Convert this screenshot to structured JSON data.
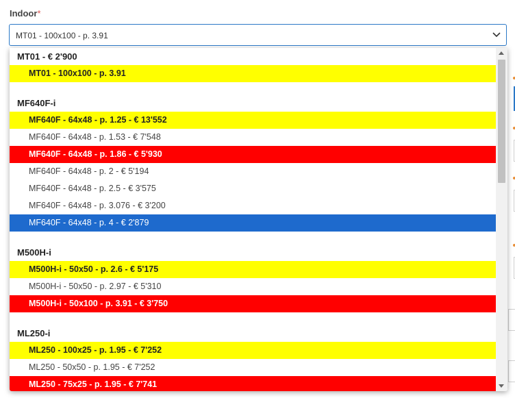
{
  "field": {
    "label": "Indoor",
    "required_mark": "*",
    "selected_value": "MT01 - 100x100 - p. 3.91"
  },
  "colors": {
    "highlight_yellow": "#ffff00",
    "highlight_red": "#ff0000",
    "selected_blue": "#1e6acd",
    "focus_border": "#2a78c7",
    "required": "#d9534f"
  },
  "groups": [
    {
      "label": "MT01 - € 2'900",
      "options": [
        {
          "text": "MT01 - 100x100 - p. 3.91",
          "style": "yellow"
        }
      ]
    },
    {
      "label": "MF640F-i",
      "options": [
        {
          "text": "MF640F - 64x48 - p. 1.25 - € 13'552",
          "style": "yellow"
        },
        {
          "text": "MF640F - 64x48 - p. 1.53 - € 7'548",
          "style": "plain"
        },
        {
          "text": "MF640F - 64x48 - p. 1.86 - € 5'930",
          "style": "red"
        },
        {
          "text": "MF640F - 64x48 - p. 2 - € 5'194",
          "style": "plain"
        },
        {
          "text": "MF640F - 64x48 - p. 2.5 - € 3'575",
          "style": "plain"
        },
        {
          "text": "MF640F - 64x48 - p. 3.076 - € 3'200",
          "style": "plain"
        },
        {
          "text": "MF640F - 64x48 - p. 4 - € 2'879",
          "style": "selected"
        }
      ]
    },
    {
      "label": "M500H-i",
      "options": [
        {
          "text": "M500H-i - 50x50 - p. 2.6 - € 5'175",
          "style": "yellow"
        },
        {
          "text": "M500H-i - 50x50 - p. 2.97 - € 5'310",
          "style": "plain"
        },
        {
          "text": "M500H-i - 50x100 - p. 3.91 - € 3'750",
          "style": "red"
        }
      ]
    },
    {
      "label": "ML250-i",
      "options": [
        {
          "text": "ML250 - 100x25 - p. 1.95 - € 7'252",
          "style": "yellow"
        },
        {
          "text": "ML250 - 50x50 - p. 1.95 - € 7'252",
          "style": "plain"
        },
        {
          "text": "ML250 - 75x25 - p. 1.95 - € 7'741",
          "style": "red"
        }
      ]
    }
  ],
  "icons": {
    "select_arrow": "chevron-down-icon",
    "scroll_up": "arrow-up-icon",
    "scroll_down": "arrow-down-icon"
  }
}
